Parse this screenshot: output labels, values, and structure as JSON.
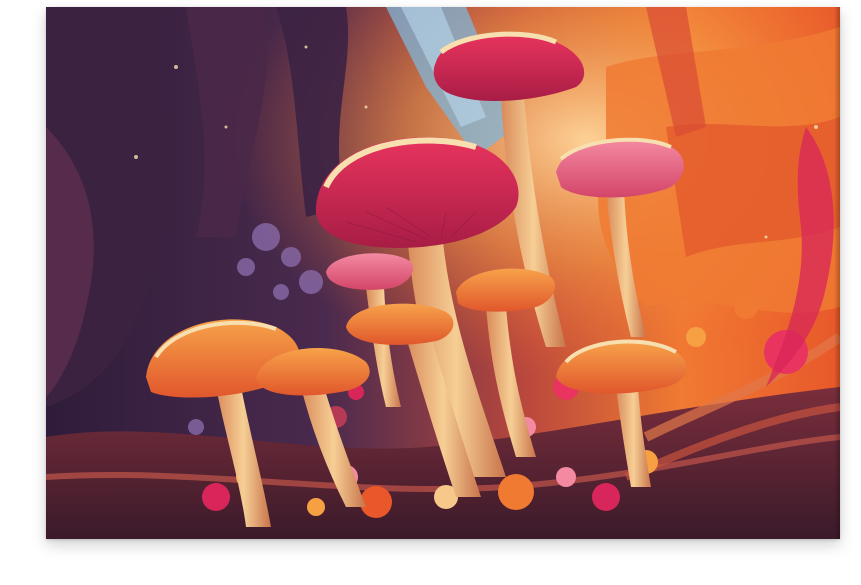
{
  "artwork": {
    "subject": "mushroom-forest-illustration",
    "palette": {
      "deep_purple": "#3a2240",
      "plum": "#5e2e4f",
      "magenta": "#d8265a",
      "crimson": "#c41f4d",
      "orange": "#f3702f",
      "amber": "#f6a043",
      "peach": "#f6c88a",
      "cream": "#f7dfb0",
      "sky_blue": "#7fb6d9",
      "lavender": "#8a6aa8"
    }
  }
}
